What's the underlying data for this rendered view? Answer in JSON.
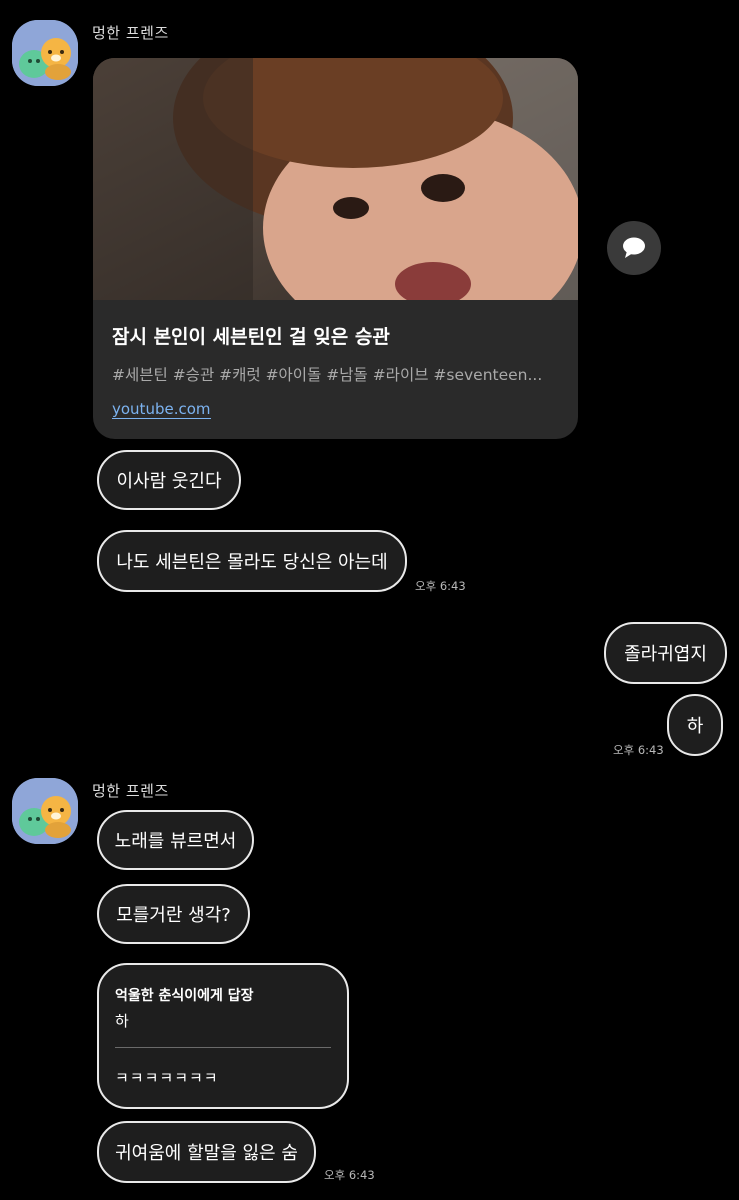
{
  "chat": {
    "sender_name": "멍한 프렌즈",
    "link_card": {
      "title": "잠시 본인이 세븐틴인 걸 잊은 승관",
      "tags": "#세븐틴 #승관 #캐럿 #아이돌 #남돌 #라이브 #seventeen...",
      "domain": "youtube.com"
    },
    "share_icon": "speech-bubble-icon",
    "messages_group1": [
      {
        "text": "이사람 웃긴다"
      },
      {
        "text": "나도 세븐틴은 몰라도 당신은 아는데",
        "time": "오후 6:43"
      }
    ],
    "my_messages": [
      {
        "text": "졸라귀엽지"
      },
      {
        "text": "하",
        "time": "오후 6:43"
      }
    ],
    "messages_group2": [
      {
        "text": "노래를 뷰르면서"
      },
      {
        "text": "모를거란 생각?"
      }
    ],
    "reply": {
      "reply_to": "억울한 춘식이에게 답장",
      "quoted": "하",
      "text": "ㅋㅋㅋㅋㅋㅋㅋ"
    },
    "last_message": {
      "text": "귀여움에 할말을 잃은 숨",
      "time": "오후 6:43"
    }
  }
}
